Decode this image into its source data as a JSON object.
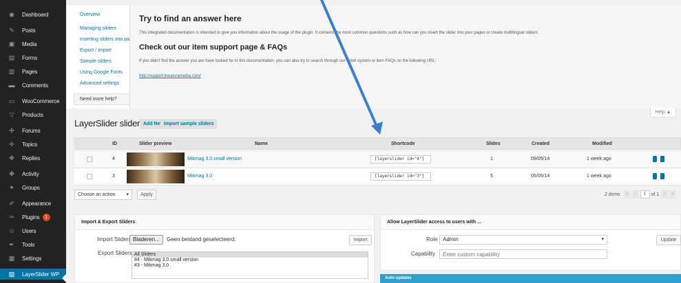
{
  "sidebar": {
    "items": [
      {
        "label": "Dashboard",
        "icon": "dashboard-icon",
        "glyph": "◉"
      },
      {
        "label": "Posts",
        "icon": "pin-icon",
        "glyph": "✎"
      },
      {
        "label": "Media",
        "icon": "media-icon",
        "glyph": "▣"
      },
      {
        "label": "Forms",
        "icon": "forms-icon",
        "glyph": "▤"
      },
      {
        "label": "Pages",
        "icon": "pages-icon",
        "glyph": "▥"
      },
      {
        "label": "Comments",
        "icon": "comments-icon",
        "glyph": "▬"
      },
      {
        "label": "WooCommerce",
        "icon": "woocommerce-icon",
        "glyph": "▭"
      },
      {
        "label": "Products",
        "icon": "products-icon",
        "glyph": "▽"
      },
      {
        "label": "Forums",
        "icon": "forums-icon",
        "glyph": "✣"
      },
      {
        "label": "Topics",
        "icon": "topics-icon",
        "glyph": "✢"
      },
      {
        "label": "Replies",
        "icon": "replies-icon",
        "glyph": "✥"
      },
      {
        "label": "Activity",
        "icon": "activity-icon",
        "glyph": "✤"
      },
      {
        "label": "Groups",
        "icon": "groups-icon",
        "glyph": "✦"
      },
      {
        "label": "Appearance",
        "icon": "appearance-icon",
        "glyph": "✐"
      },
      {
        "label": "Plugins",
        "icon": "plugins-icon",
        "glyph": "✑",
        "badge": "1"
      },
      {
        "label": "Users",
        "icon": "users-icon",
        "glyph": "☺"
      },
      {
        "label": "Tools",
        "icon": "tools-icon",
        "glyph": "✒"
      },
      {
        "label": "Settings",
        "icon": "settings-icon",
        "glyph": "▦"
      },
      {
        "label": "LayerSlider WP",
        "icon": "layerslider-icon",
        "glyph": "▧",
        "current": true
      }
    ]
  },
  "help": {
    "tabs": [
      "Overview",
      "Managing sliders",
      "Inserting sliders into pages",
      "Export / Import",
      "Sample sliders",
      "Using Google Fonts",
      "Advanced settings",
      "Need more help?"
    ],
    "active_tab": "Need more help?",
    "heading1": "Try to find an answer here",
    "para1": "This integrated documentation is intended to give you information about the usage of the plugin. It contains the most common questions such as how can you insert the slider into your pages or create multilingual sliders.",
    "heading2": "Check out our item support page & FAQs",
    "para2": "If you didn't find the answer you are have looked for in this documentation, you can also try to search through our ticket system or item FAQs on the following URL:",
    "link": "http://support.kreaturamedia.com/",
    "toggle": "Help ▲"
  },
  "page": {
    "title": "LayerSlider sliders",
    "add_new": "Add New",
    "import_samples": "Import sample sliders"
  },
  "table": {
    "headers": {
      "id": "ID",
      "preview": "Slider preview",
      "name": "Name",
      "shortcode": "Shortcode",
      "slides": "Slides",
      "created": "Created",
      "modified": "Modified"
    },
    "rows": [
      {
        "id": "4",
        "name": "Mikmag 3.0 small version",
        "shortcode": "[layerslider id=\"4\"]",
        "slides": "1",
        "created": "09/05/14",
        "modified": "1 week ago"
      },
      {
        "id": "3",
        "name": "Mikmag 3.0",
        "shortcode": "[layerslider id=\"3\"]",
        "slides": "5",
        "created": "05/05/14",
        "modified": "1 week ago"
      }
    ]
  },
  "bulk": {
    "select_value": "Choose an action",
    "apply": "Apply",
    "items": "2 items",
    "first": "«",
    "prev": "‹",
    "page": "1",
    "of": "of 1",
    "next": "›",
    "last": "»"
  },
  "import_export": {
    "title": "Import & Export Sliders",
    "import_label": "Import Sliders",
    "browse": "Bladeren...",
    "no_file": "Geen bestand geselecteerd.",
    "import_button": "Import",
    "export_label": "Export Sliders",
    "export_options": [
      "All Sliders",
      "#4   - Mikmag 3.0 small version",
      "#3   - Mikmag 3.0"
    ]
  },
  "access": {
    "title": "Allow LayerSlider access to users with ...",
    "role_label": "Role",
    "role_value": "Admin",
    "update": "Update",
    "capability_label": "Capability",
    "capability_placeholder": "Enter custom capability"
  },
  "autoupdates": {
    "title": "Auto-updates"
  },
  "colors": {
    "sidebar_bg": "#222222",
    "accent": "#0074a2",
    "badge": "#d54e21",
    "annotation_arrow": "#3d7ec6"
  }
}
